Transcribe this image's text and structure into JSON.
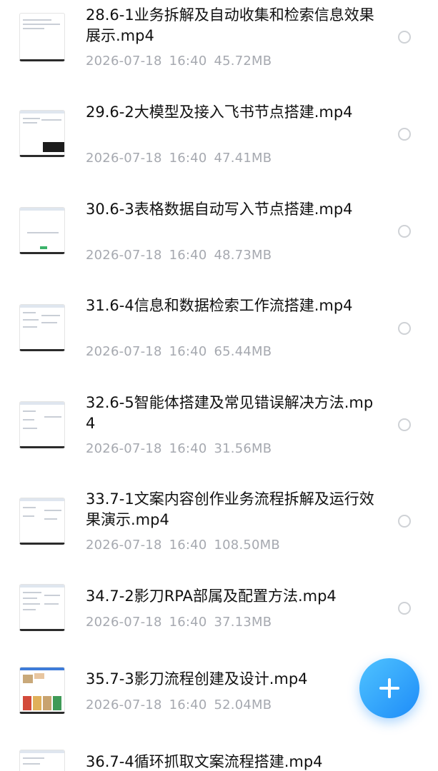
{
  "files": [
    {
      "name": "28.6-1业务拆解及自动收集和检索信息效果展示.mp4",
      "date": "2026-07-18",
      "time": "16:40",
      "size": "45.72MB"
    },
    {
      "name": "29.6-2大模型及接入飞书节点搭建.mp4",
      "date": "2026-07-18",
      "time": "16:40",
      "size": "47.41MB"
    },
    {
      "name": "30.6-3表格数据自动写入节点搭建.mp4",
      "date": "2026-07-18",
      "time": "16:40",
      "size": "48.73MB"
    },
    {
      "name": "31.6-4信息和数据检索工作流搭建.mp4",
      "date": "2026-07-18",
      "time": "16:40",
      "size": "65.44MB"
    },
    {
      "name": "32.6-5智能体搭建及常见错误解决方法.mp4",
      "date": "2026-07-18",
      "time": "16:40",
      "size": "31.56MB"
    },
    {
      "name": "33.7-1文案内容创作业务流程拆解及运行效果演示.mp4",
      "date": "2026-07-18",
      "time": "16:40",
      "size": "108.50MB"
    },
    {
      "name": "34.7-2影刀RPA部属及配置方法.mp4",
      "date": "2026-07-18",
      "time": "16:40",
      "size": "37.13MB"
    },
    {
      "name": "35.7-3影刀流程创建及设计.mp4",
      "date": "2026-07-18",
      "time": "16:40",
      "size": "52.04MB"
    },
    {
      "name": "36.7-4循环抓取文案流程搭建.mp4",
      "date": "",
      "time": "",
      "size": ""
    }
  ],
  "icons": {
    "thumbnail": "video-thumbnail-icon",
    "select": "radio-circle-icon",
    "add": "plus-icon"
  },
  "colors": {
    "title": "#111111",
    "meta": "#a6a9b0",
    "accent": "#1e8cf8"
  }
}
